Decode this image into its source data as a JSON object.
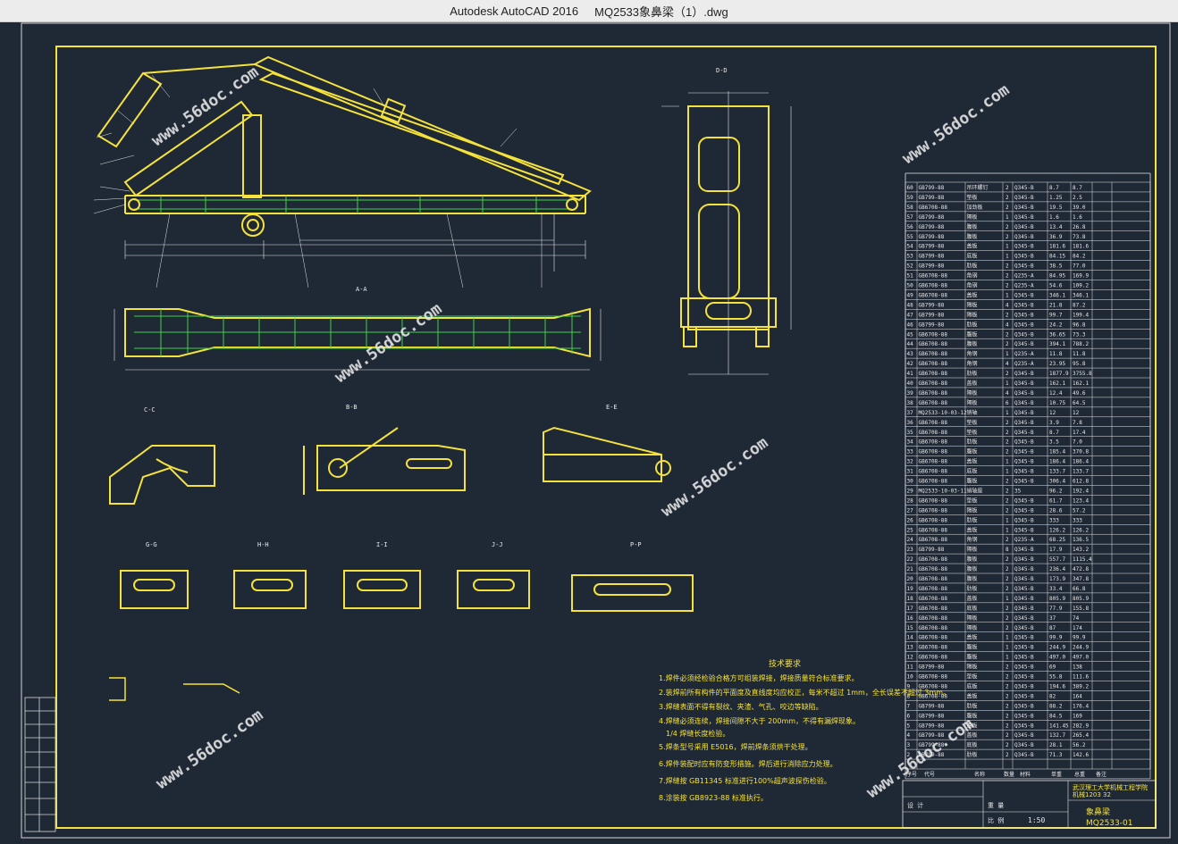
{
  "window": {
    "app": "Autodesk AutoCAD 2016",
    "file": "MQ2533象鼻梁（1）.dwg"
  },
  "drawing": {
    "section_labels": [
      "A-A",
      "B-B",
      "C-C",
      "D-D",
      "E-E",
      "G-G",
      "H-H",
      "I-I",
      "J-J",
      "P-P"
    ],
    "tech_title": "技术要求",
    "tech_notes": [
      "1.焊件必须经检验合格方可组装焊接，焊接质量符合标准要求。",
      "2.装焊前所有构件的平面度及直线度均应校正，每米不超过 1mm，全长误差不超过 3mm。",
      "3.焊缝表面不得有裂纹、夹渣、气孔、咬边等缺陷。",
      "4.焊缝必须连续，焊接间隙不大于 200mm，不得有漏焊现象。",
      "1/4 焊缝长度检验。",
      "5.焊条型号采用 E5016，焊前焊条须烘干处理。",
      "6.焊件装配时应有防变形措施。焊后进行消除应力处理。",
      "7.焊缝按 GB11345 标准进行100%超声波探伤检验。",
      "8.涂装按 GB8923-88 标准执行。"
    ],
    "scale": "1:50",
    "drawing_no": "MQ2533-01",
    "part_name": "象鼻梁",
    "watermark": "www.56doc.com",
    "bom_header": [
      "序号",
      "代号",
      "名称",
      "数量",
      "材料",
      "单重",
      "总重",
      "备注"
    ],
    "bom_rows": [
      [
        "60",
        "GB799-88",
        "吊环螺钉",
        "2",
        "Q345-B",
        "8.7",
        "8.7"
      ],
      [
        "59",
        "GB799-88",
        "垫板",
        "2",
        "Q345-B",
        "1.25",
        "2.5"
      ],
      [
        "58",
        "GB6708-88",
        "加劲板",
        "2",
        "Q345-B",
        "19.5",
        "39.0"
      ],
      [
        "57",
        "GB799-88",
        "隔板",
        "1",
        "Q345-B",
        "1.6",
        "1.6"
      ],
      [
        "56",
        "GB799-88",
        "腹板",
        "2",
        "Q345-B",
        "13.4",
        "26.8"
      ],
      [
        "55",
        "GB799-88",
        "腹板",
        "2",
        "Q345-B",
        "36.9",
        "73.8"
      ],
      [
        "54",
        "GB799-88",
        "盖板",
        "1",
        "Q345-B",
        "181.6",
        "181.6"
      ],
      [
        "53",
        "GB799-88",
        "底板",
        "1",
        "Q345-B",
        "84.15",
        "84.2"
      ],
      [
        "52",
        "GB799-88",
        "肋板",
        "2",
        "Q345-B",
        "38.5",
        "77.0"
      ],
      [
        "51",
        "GB6708-88",
        "角钢",
        "2",
        "Q235-A",
        "84.95",
        "169.9"
      ],
      [
        "50",
        "GB6708-88",
        "角钢",
        "2",
        "Q235-A",
        "54.6",
        "109.2"
      ],
      [
        "49",
        "GB6708-88",
        "盖板",
        "1",
        "Q345-B",
        "346.1",
        "346.1"
      ],
      [
        "48",
        "GB799-88",
        "隔板",
        "4",
        "Q345-B",
        "21.8",
        "87.2"
      ],
      [
        "47",
        "GB799-88",
        "隔板",
        "2",
        "Q345-B",
        "99.7",
        "199.4"
      ],
      [
        "46",
        "GB799-88",
        "肋板",
        "4",
        "Q345-B",
        "24.2",
        "96.8"
      ],
      [
        "45",
        "GB6708-88",
        "腹板",
        "2",
        "Q345-B",
        "36.65",
        "73.3"
      ],
      [
        "44",
        "GB6708-88",
        "腹板",
        "2",
        "Q345-B",
        "394.1",
        "788.2"
      ],
      [
        "43",
        "GB6708-88",
        "角钢",
        "1",
        "Q235-A",
        "11.8",
        "11.8"
      ],
      [
        "42",
        "GB6708-88",
        "角钢",
        "4",
        "Q235-A",
        "23.95",
        "95.8"
      ],
      [
        "41",
        "GB6708-88",
        "肋板",
        "2",
        "Q345-B",
        "1877.9",
        "3755.8"
      ],
      [
        "40",
        "GB6708-88",
        "盖板",
        "1",
        "Q345-B",
        "162.1",
        "162.1"
      ],
      [
        "39",
        "GB6708-88",
        "隔板",
        "4",
        "Q345-B",
        "12.4",
        "49.6"
      ],
      [
        "38",
        "GB6708-88",
        "隔板",
        "6",
        "Q345-B",
        "10.75",
        "64.5"
      ],
      [
        "37",
        "MQ2533-10-03-12",
        "销轴",
        "1",
        "Q345-B",
        "12",
        "12"
      ],
      [
        "36",
        "GB6708-88",
        "垫板",
        "2",
        "Q345-B",
        "3.9",
        "7.8"
      ],
      [
        "35",
        "GB6708-88",
        "垫板",
        "2",
        "Q345-B",
        "8.7",
        "17.4"
      ],
      [
        "34",
        "GB6708-88",
        "肋板",
        "2",
        "Q345-B",
        "3.5",
        "7.0"
      ],
      [
        "33",
        "GB6708-88",
        "腹板",
        "2",
        "Q345-B",
        "185.4",
        "370.8"
      ],
      [
        "32",
        "GB6708-88",
        "盖板",
        "1",
        "Q345-B",
        "186.4",
        "186.4"
      ],
      [
        "31",
        "GB6708-88",
        "底板",
        "1",
        "Q345-B",
        "133.7",
        "133.7"
      ],
      [
        "30",
        "GB6708-88",
        "腹板",
        "2",
        "Q345-B",
        "306.4",
        "612.8"
      ],
      [
        "29",
        "MQ2533-10-03-11",
        "销轴座",
        "2",
        "35",
        "96.2",
        "192.4"
      ],
      [
        "28",
        "GB6708-88",
        "垫板",
        "2",
        "Q345-B",
        "61.7",
        "123.4"
      ],
      [
        "27",
        "GB6708-88",
        "隔板",
        "2",
        "Q345-B",
        "28.6",
        "57.2"
      ],
      [
        "26",
        "GB6708-88",
        "肋板",
        "1",
        "Q345-B",
        "333",
        "333"
      ],
      [
        "25",
        "GB6708-88",
        "盖板",
        "1",
        "Q345-B",
        "126.2",
        "126.2"
      ],
      [
        "24",
        "GB6708-88",
        "角钢",
        "2",
        "Q235-A",
        "68.25",
        "136.5"
      ],
      [
        "23",
        "GB799-88",
        "隔板",
        "8",
        "Q345-B",
        "17.9",
        "143.2"
      ],
      [
        "22",
        "GB6708-88",
        "腹板",
        "2",
        "Q345-B",
        "557.7",
        "1115.4"
      ],
      [
        "21",
        "GB6708-88",
        "腹板",
        "2",
        "Q345-B",
        "236.4",
        "472.8"
      ],
      [
        "20",
        "GB6708-88",
        "腹板",
        "2",
        "Q345-B",
        "173.9",
        "347.8"
      ],
      [
        "19",
        "GB6708-88",
        "肋板",
        "2",
        "Q345-B",
        "33.4",
        "66.8"
      ],
      [
        "18",
        "GB6708-88",
        "盖板",
        "1",
        "Q345-B",
        "805.9",
        "805.9"
      ],
      [
        "17",
        "GB6708-88",
        "底板",
        "2",
        "Q345-B",
        "77.9",
        "155.8"
      ],
      [
        "16",
        "GB6708-88",
        "隔板",
        "2",
        "Q345-B",
        "37",
        "74"
      ],
      [
        "15",
        "GB6708-88",
        "隔板",
        "2",
        "Q345-B",
        "87",
        "174"
      ],
      [
        "14",
        "GB6708-88",
        "盖板",
        "1",
        "Q345-B",
        "99.9",
        "99.9"
      ],
      [
        "13",
        "GB6708-88",
        "腹板",
        "1",
        "Q345-B",
        "244.9",
        "244.9"
      ],
      [
        "12",
        "GB6708-88",
        "腹板",
        "1",
        "Q345-B",
        "497.0",
        "497.0"
      ],
      [
        "11",
        "GB799-88",
        "隔板",
        "2",
        "Q345-B",
        "69",
        "138"
      ],
      [
        "10",
        "GB6708-88",
        "垫板",
        "2",
        "Q345-B",
        "55.8",
        "111.6"
      ],
      [
        "9",
        "GB6708-88",
        "底板",
        "2",
        "Q345-B",
        "194.6",
        "389.2"
      ],
      [
        "8",
        "GB6708-88",
        "盖板",
        "2",
        "Q345-B",
        "82",
        "164"
      ],
      [
        "7",
        "GB799-88",
        "肋板",
        "2",
        "Q345-B",
        "88.2",
        "176.4"
      ],
      [
        "6",
        "GB799-88",
        "腹板",
        "2",
        "Q345-B",
        "84.5",
        "169"
      ],
      [
        "5",
        "GB799-88",
        "腹板",
        "2",
        "Q345-B",
        "141.45",
        "282.9"
      ],
      [
        "4",
        "GB799-88",
        "盖板",
        "2",
        "Q345-B",
        "132.7",
        "265.4"
      ],
      [
        "3",
        "GB799-88",
        "底板",
        "2",
        "Q345-B",
        "28.1",
        "56.2"
      ],
      [
        "2",
        "GB799-88",
        "肋板",
        "2",
        "Q345-B",
        "71.3",
        "142.6"
      ]
    ],
    "title_block": {
      "school": "武汉理工大学机械工程学院",
      "class": "机械1203 32",
      "weight_label": "重 量",
      "scale_label": "比 例",
      "design_label": "设 计"
    }
  }
}
